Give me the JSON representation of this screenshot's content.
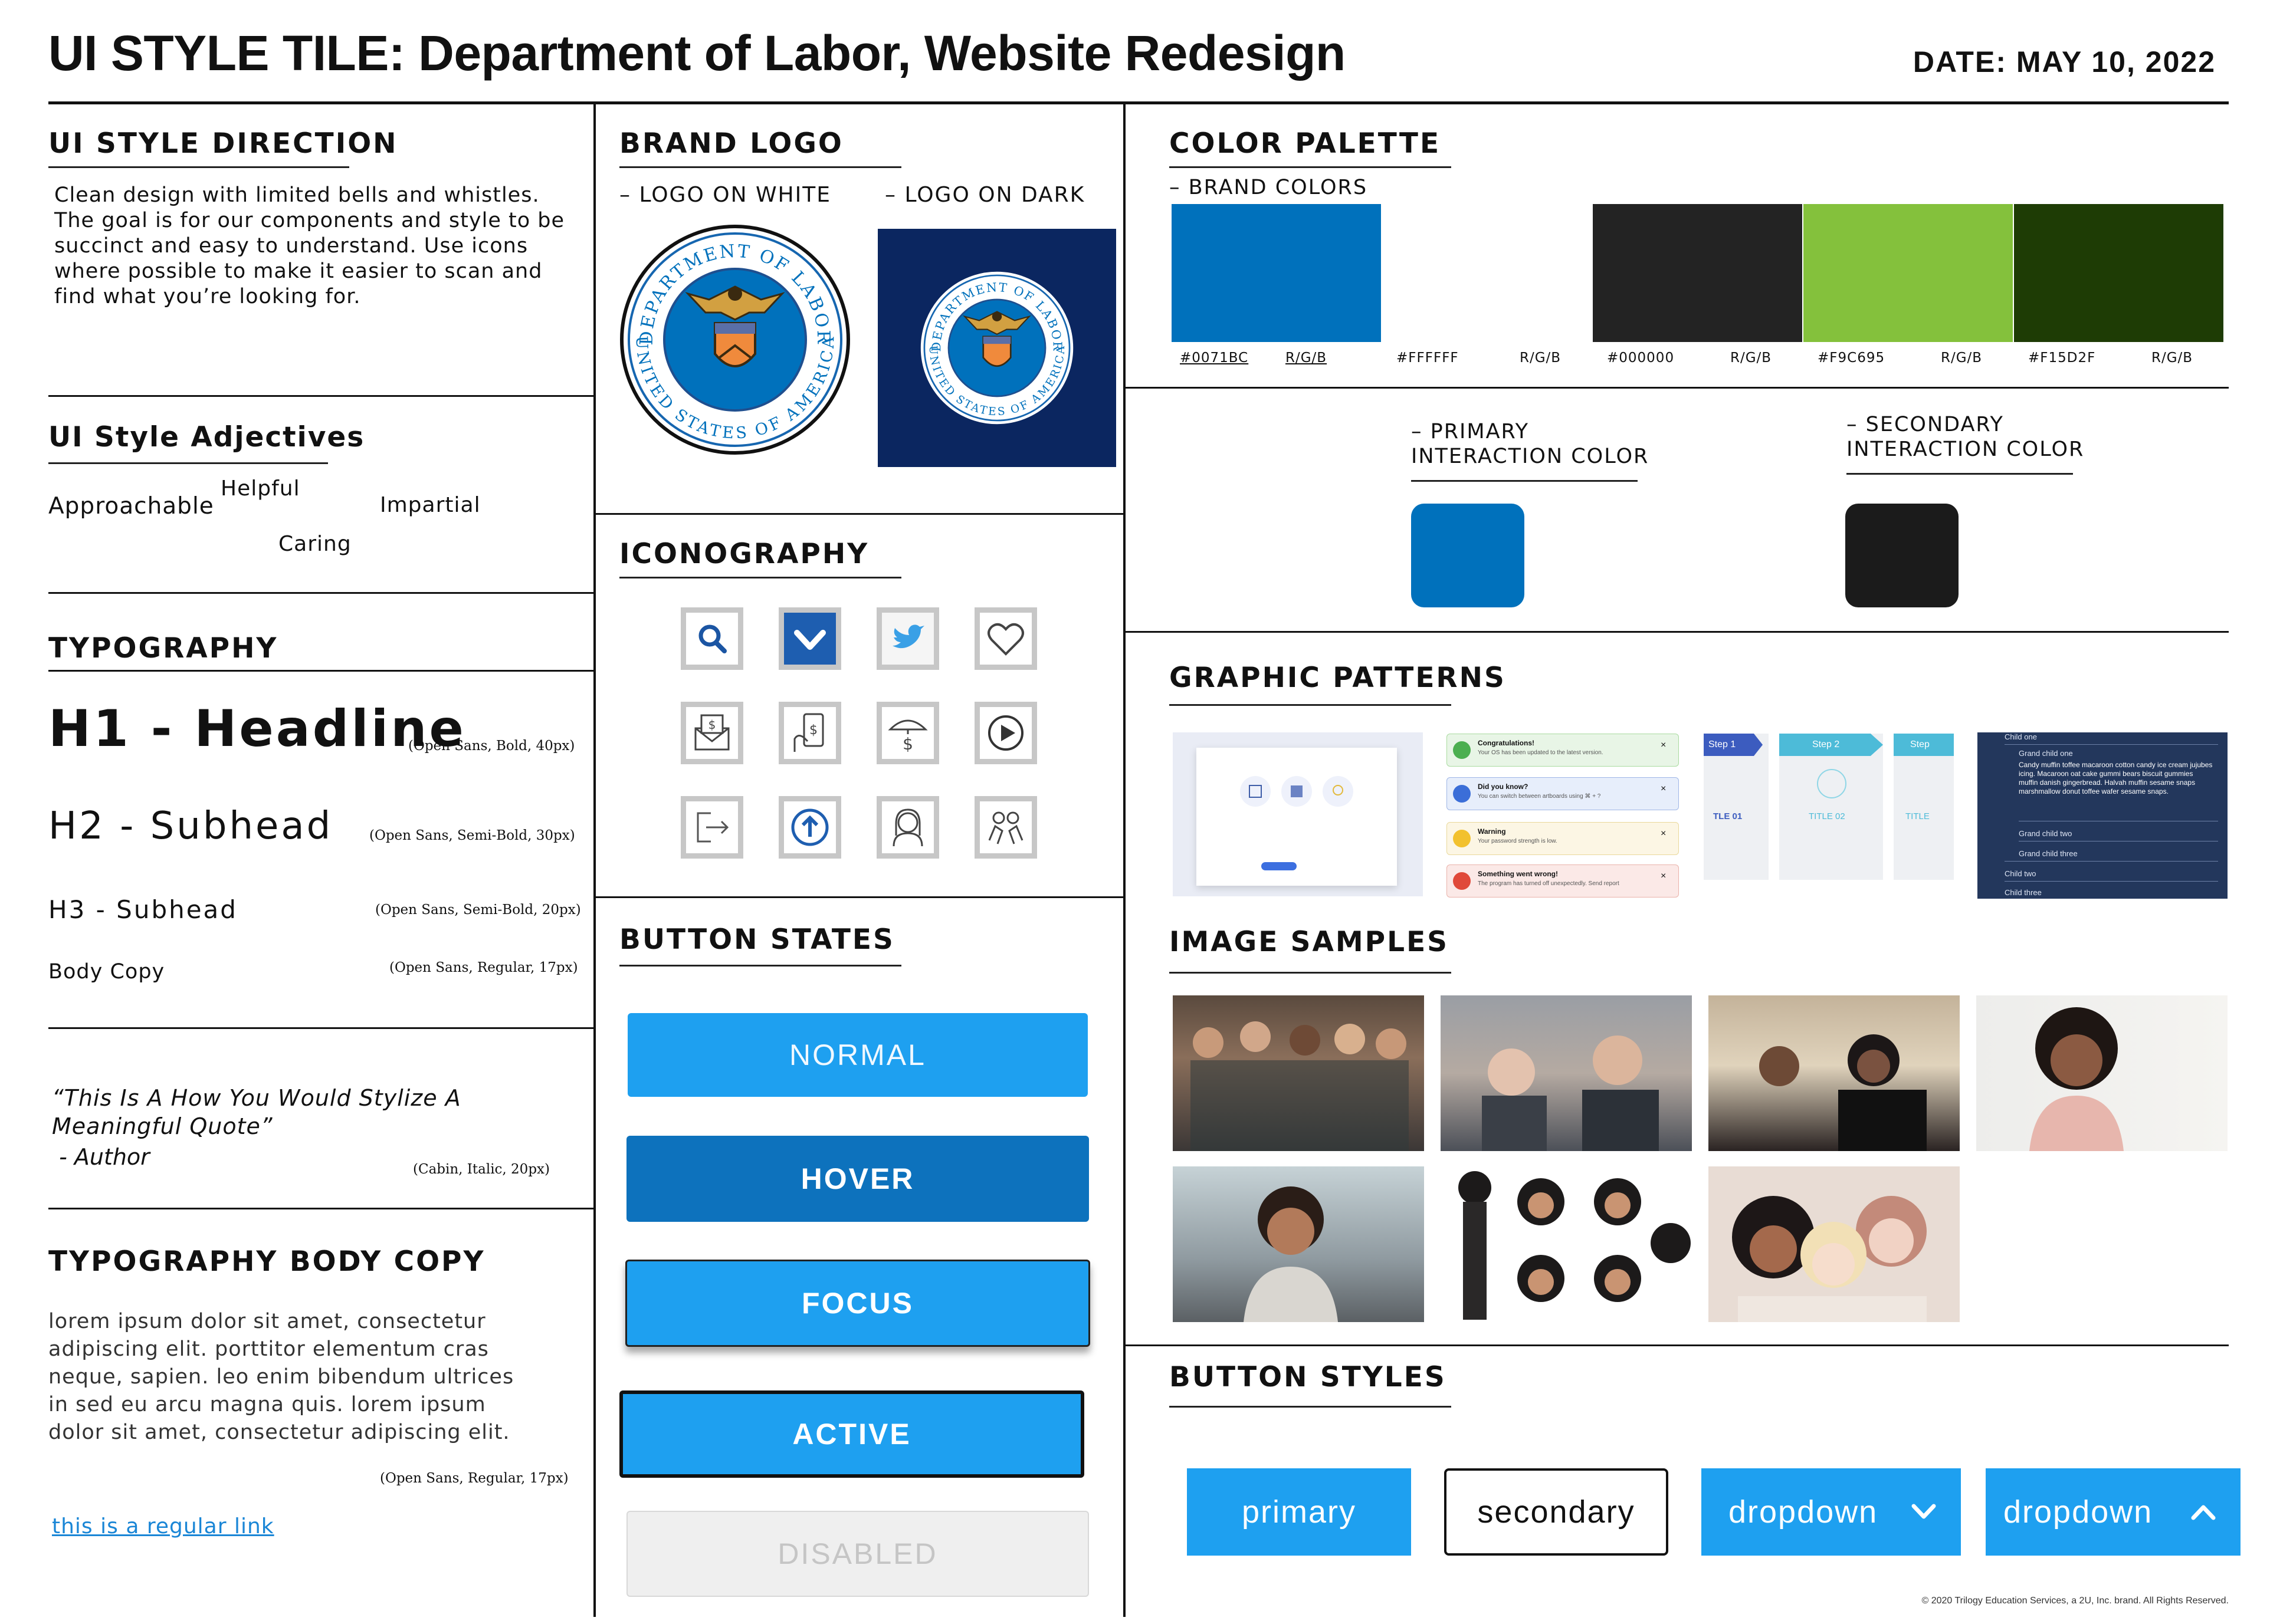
{
  "header": {
    "title": "UI STYLE TILE: Department of Labor, Website Redesign",
    "date": "DATE: MAY 10, 2022"
  },
  "style_direction": {
    "title": "UI STYLE DIRECTION",
    "text": "Clean design with limited bells and whistles. The goal is for our components and style to be succinct and easy to understand. Use icons where possible to make it easier to scan and find what you’re looking for."
  },
  "adjectives": {
    "title": "UI Style Adjectives",
    "words": [
      "Approachable",
      "Helpful",
      "Impartial",
      "Caring"
    ]
  },
  "typography": {
    "title": "TYPOGRAPHY",
    "h1": "H1 - Headline",
    "h1_note": "(Open Sans, Bold, 40px)",
    "h2": "H2 - Subhead",
    "h2_note": "(Open Sans, Semi-Bold, 30px)",
    "h3": "H3 - Subhead",
    "h3_note": "(Open Sans, Semi-Bold, 20px)",
    "body": "Body Copy",
    "body_note": "(Open Sans, Regular, 17px)",
    "quote": "“This Is A How You Would Stylize A Meaningful Quote”",
    "author": " - Author",
    "quote_note": "(Cabin, Italic, 20px)"
  },
  "body_copy": {
    "title": "TYPOGRAPHY BODY COPY",
    "text": "lorem ipsum dolor sit amet, consectetur adipiscing elit. porttitor elementum cras neque, sapien. leo enim bibendum ultrices in sed eu arcu magna quis. lorem ipsum dolor sit amet, consectetur adipiscing elit.",
    "note": "(Open Sans, Regular, 17px)",
    "link": "this is a regular link"
  },
  "brand_logo": {
    "title": "BRAND LOGO",
    "on_white": "– LOGO ON WHITE",
    "on_dark": "– LOGO ON DARK",
    "seal_top": "DEPARTMENT OF LABOR",
    "seal_bottom": "UNITED STATES OF AMERICA"
  },
  "iconography": {
    "title": "ICONOGRAPHY",
    "icons": [
      "search-icon",
      "chevron-down-icon",
      "twitter-icon",
      "heart-icon",
      "money-envelope-icon",
      "mobile-payment-icon",
      "umbrella-dollar-icon",
      "play-icon",
      "logout-icon",
      "upload-icon",
      "person-icon",
      "people-group-icon"
    ]
  },
  "button_states": {
    "title": "BUTTON STATES",
    "normal": "NORMAL",
    "hover": "HOVER",
    "focus": "FOCUS",
    "active": "ACTIVE",
    "disabled": "DISABLED"
  },
  "color_palette": {
    "title": "COLOR PALETTE",
    "brand_label": "– BRAND COLORS",
    "swatches": [
      {
        "hex": "#0071BC",
        "rgb": "R/G/B",
        "color": "#0071bc"
      },
      {
        "hex": "#FFFFFF",
        "rgb": "R/G/B",
        "color": "#ffffff"
      },
      {
        "hex": "#000000",
        "rgb": "R/G/B",
        "color": "#232323"
      },
      {
        "hex": "#F9C695",
        "rgb": "R/G/B",
        "color": "#84c13c"
      },
      {
        "hex": "#F15D2F",
        "rgb": "R/G/B",
        "color": "#1e3c05"
      }
    ],
    "primary_label_1": "– PRIMARY",
    "primary_label_2": "INTERACTION COLOR",
    "primary_color": "#0071bc",
    "secondary_label_1": "– SECONDARY",
    "secondary_label_2": "INTERACTION COLOR",
    "secondary_color": "#1b1b1b"
  },
  "graphic_patterns": {
    "title": "GRAPHIC PATTERNS",
    "alerts": [
      {
        "title": "Congratulations!",
        "text": "Your OS has been updated to the latest version."
      },
      {
        "title": "Did you know?",
        "text": "You can switch between artboards using ⌘ + ?"
      },
      {
        "title": "Warning",
        "text": "Your password strength is low."
      },
      {
        "title": "Something went wrong!",
        "text": "The program has turned off unexpectedly. Send report"
      }
    ],
    "steps": [
      "Step 1",
      "Step 2",
      "Step"
    ],
    "step_titles": [
      "TLE 01",
      "TITLE 02",
      "TITLE"
    ],
    "accordion": {
      "items": [
        "Child one",
        "Grand child one",
        "Grand child two",
        "Grand child three",
        "Child two",
        "Child three"
      ],
      "text": "Candy muffin toffee macaroon cotton candy ice cream jujubes icing. Macaroon oat cake gummi bears biscuit gummies muffin danish gingerbread. Halvah muffin sesame snaps marshmallow donut toffee wafer sesame snaps."
    }
  },
  "image_samples": {
    "title": "IMAGE SAMPLES"
  },
  "button_styles": {
    "title": "BUTTON STYLES",
    "primary": "primary",
    "secondary": "secondary",
    "dropdown1": "dropdown",
    "dropdown2": "dropdown"
  },
  "footer": {
    "copyright": "© 2020 Trilogy Education Services, a 2U, Inc. brand. All Rights Reserved."
  }
}
